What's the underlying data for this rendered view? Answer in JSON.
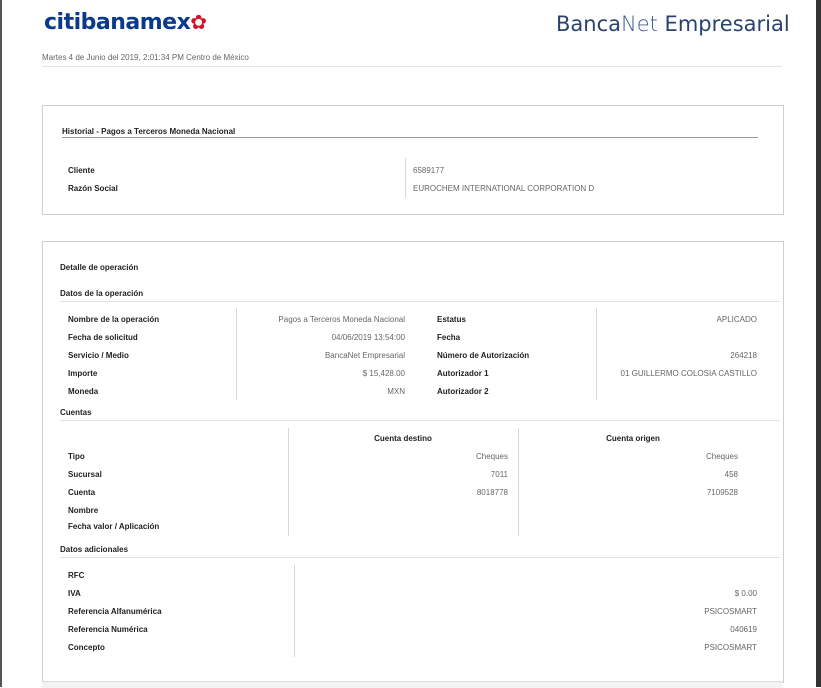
{
  "header": {
    "logo_text": "citibanamex",
    "brand_a": "Banca",
    "brand_b": "Net",
    "brand_c": " Empresarial",
    "datetime": "Martes 4 de Junio del 2019, 2:01:34 PM Centro de México"
  },
  "historial": {
    "title": "Historial - Pagos a Terceros Moneda Nacional",
    "cliente_label": "Cliente",
    "cliente_value": "6589177",
    "razon_label": "Razón Social",
    "razon_value": "EUROCHEM INTERNATIONAL CORPORATION D"
  },
  "detalle": {
    "title": "Detalle de operación",
    "datos_title": "Datos de la operación",
    "left_rows": [
      {
        "label": "Nombre de la operación",
        "value": "Pagos a Terceros Moneda Nacional"
      },
      {
        "label": "Fecha de solicitud",
        "value": "04/06/2019 13:54:00"
      },
      {
        "label": "Servicio / Medio",
        "value": "BancaNet Empresarial"
      },
      {
        "label": "Importe",
        "value": "$ 15,428.00"
      },
      {
        "label": "Moneda",
        "value": "MXN"
      }
    ],
    "right_rows": [
      {
        "label": "Estatus",
        "value": "APLICADO"
      },
      {
        "label": "Fecha",
        "value": ""
      },
      {
        "label": "Número de Autorización",
        "value": "264218"
      },
      {
        "label": "Autorizador 1",
        "value": "01 GUILLERMO COLOSIA CASTILLO"
      },
      {
        "label": "Autorizador 2",
        "value": ""
      }
    ]
  },
  "cuentas": {
    "title": "Cuentas",
    "col_destino": "Cuenta destino",
    "col_origen": "Cuenta origen",
    "rows": [
      {
        "label": "Tipo",
        "destino": "Cheques",
        "origen": "Cheques"
      },
      {
        "label": "Sucursal",
        "destino": "7011",
        "origen": "458"
      },
      {
        "label": "Cuenta",
        "destino": "8018778",
        "origen": "7109528"
      },
      {
        "label": "Nombre",
        "destino": "",
        "origen": ""
      },
      {
        "label": "Fecha valor / Aplicación",
        "destino": "",
        "origen": ""
      }
    ]
  },
  "adicionales": {
    "title": "Datos adicionales",
    "rows": [
      {
        "label": "RFC",
        "value": ""
      },
      {
        "label": "IVA",
        "value": "$ 0.00"
      },
      {
        "label": "Referencia Alfanumérica",
        "value": "PSICOSMART"
      },
      {
        "label": "Referencia Numérica",
        "value": "040619"
      },
      {
        "label": "Concepto",
        "value": "PSICOSMART"
      }
    ]
  },
  "colors": {
    "brand_blue": "#0a3a8c",
    "brand_red": "#d3132b"
  }
}
